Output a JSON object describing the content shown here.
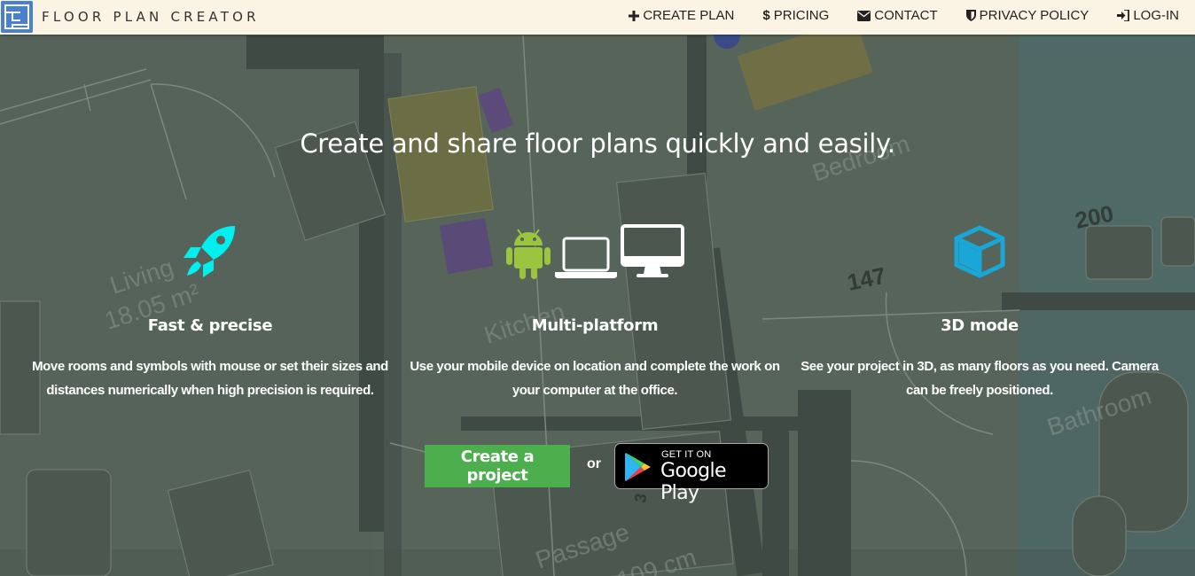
{
  "brand": {
    "name": "FLOOR PLAN CREATOR"
  },
  "nav": [
    {
      "icon": "plus-icon",
      "label": "CREATE PLAN"
    },
    {
      "icon": "dollar-icon",
      "label": "PRICING"
    },
    {
      "icon": "envelope-icon",
      "label": "CONTACT"
    },
    {
      "icon": "shield-icon",
      "label": "PRIVACY POLICY"
    },
    {
      "icon": "login-icon",
      "label": "LOG-IN"
    }
  ],
  "hero": {
    "headline": "Create and share floor plans quickly and easily."
  },
  "features": [
    {
      "icon": "rocket-icon",
      "title": "Fast & precise",
      "text": "Move rooms and symbols with mouse or set their sizes and distances numerically when high precision is required."
    },
    {
      "icon": "devices-icon",
      "title": "Multi-platform",
      "text": "Use your mobile device on location and complete the work on your computer at the office."
    },
    {
      "icon": "cube-icon",
      "title": "3D mode",
      "text": "See your project in 3D, as many floors as you need. Camera can be freely positioned."
    }
  ],
  "cta": {
    "button": "Create a project",
    "or": "or",
    "store_small": "GET IT ON",
    "store_big": "Google Play"
  },
  "background_plan": {
    "labels": [
      "Living",
      "18.05 m²",
      "Kitchen",
      "Bedroom",
      "Bathroom",
      "Passage",
      "109 cm",
      "147",
      "200",
      "3"
    ]
  },
  "colors": {
    "navbar_bg": "#fbf3e3",
    "logo_blue": "#4a7fd1",
    "cta_green": "#4cae4c",
    "rocket_cyan": "#00f0f0",
    "cube_blue": "#1aa6d6",
    "android_green": "#9bc43f"
  }
}
